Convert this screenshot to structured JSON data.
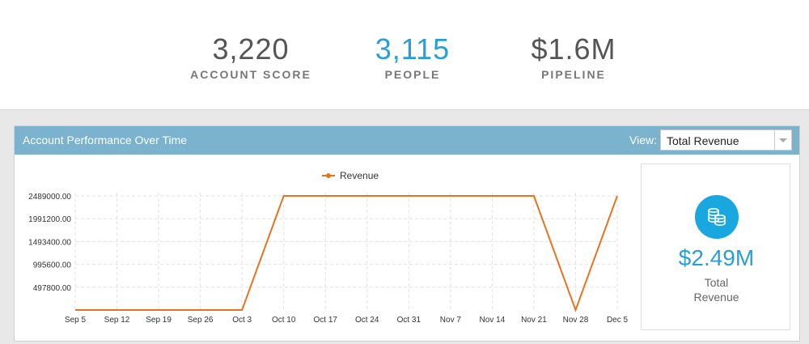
{
  "stats": [
    {
      "value": "3,220",
      "label": "ACCOUNT SCORE",
      "color": "#555555"
    },
    {
      "value": "3,115",
      "label": "PEOPLE",
      "color": "#2a9fd6"
    },
    {
      "value": "$1.6M",
      "label": "PIPELINE",
      "color": "#555555"
    }
  ],
  "panel": {
    "title": "Account Performance Over Time",
    "view_label": "View:",
    "view_selected": "Total Revenue"
  },
  "total": {
    "value": "$2.49M",
    "label_line1": "Total",
    "label_line2": "Revenue",
    "icon": "coins-icon"
  },
  "chart_data": {
    "type": "line",
    "categories": [
      "Sep 5",
      "Sep 12",
      "Sep 19",
      "Sep 26",
      "Oct 3",
      "Oct 10",
      "Oct 17",
      "Oct 24",
      "Oct 31",
      "Nov 7",
      "Nov 14",
      "Nov 21",
      "Nov 28",
      "Dec 5"
    ],
    "series": [
      {
        "name": "Revenue",
        "color": "#e8731f",
        "values": [
          0,
          0,
          0,
          0,
          0,
          2489000,
          2489000,
          2489000,
          2489000,
          2489000,
          2489000,
          2489000,
          0,
          2489000
        ]
      }
    ],
    "yticks": [
      "497800.00",
      "995600.00",
      "1493400.00",
      "1991200.00",
      "2489000.00"
    ],
    "ylim": [
      0,
      2489000
    ],
    "legend": "top-center",
    "grid": true
  }
}
